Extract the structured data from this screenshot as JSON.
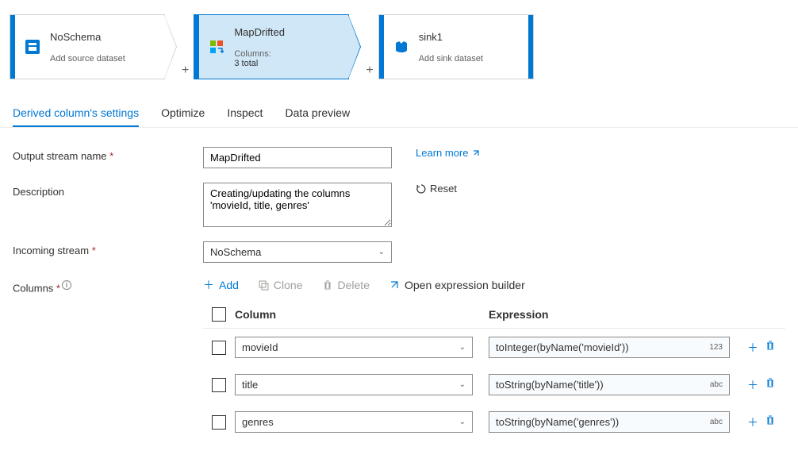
{
  "flow": {
    "nodes": [
      {
        "title": "NoSchema",
        "sub": "Add source dataset"
      },
      {
        "title": "MapDrifted",
        "subLabel": "Columns:",
        "subValue": "3 total"
      },
      {
        "title": "sink1",
        "sub": "Add sink dataset"
      }
    ],
    "addLabel": "+"
  },
  "tabs": {
    "settings": "Derived column's settings",
    "optimize": "Optimize",
    "inspect": "Inspect",
    "preview": "Data preview"
  },
  "form": {
    "outputLabel": "Output stream name",
    "outputValue": "MapDrifted",
    "learnMore": "Learn more",
    "descLabel": "Description",
    "descValue": "Creating/updating the columns 'movieId, title, genres'",
    "reset": "Reset",
    "incomingLabel": "Incoming stream",
    "incomingValue": "NoSchema",
    "columnsLabel": "Columns"
  },
  "toolbar": {
    "add": "Add",
    "clone": "Clone",
    "delete": "Delete",
    "openExpr": "Open expression builder"
  },
  "table": {
    "colHeader": "Column",
    "exprHeader": "Expression",
    "rows": [
      {
        "name": "movieId",
        "expr": "toInteger(byName('movieId'))",
        "type": "123"
      },
      {
        "name": "title",
        "expr": "toString(byName('title'))",
        "type": "abc"
      },
      {
        "name": "genres",
        "expr": "toString(byName('genres'))",
        "type": "abc"
      }
    ]
  }
}
